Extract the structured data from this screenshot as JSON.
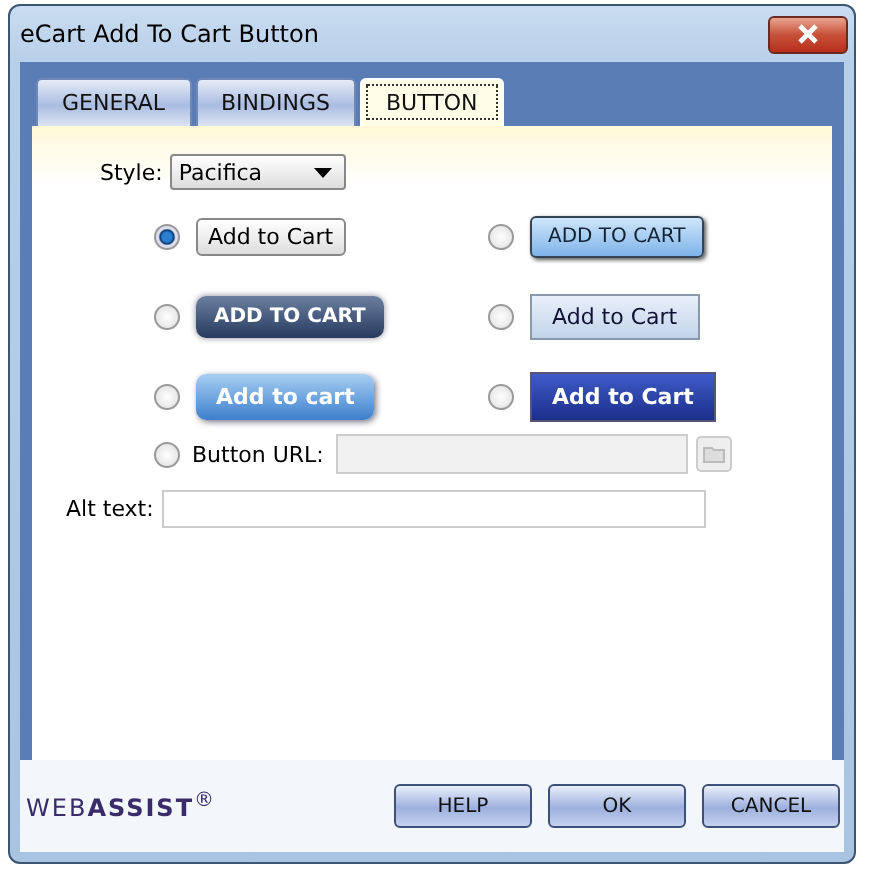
{
  "window": {
    "title": "eCart Add To Cart Button"
  },
  "tabs": [
    {
      "label": "GENERAL",
      "selected": false
    },
    {
      "label": "BINDINGS",
      "selected": false
    },
    {
      "label": "BUTTON",
      "selected": true
    }
  ],
  "style": {
    "label": "Style:",
    "value": "Pacifica"
  },
  "options": [
    {
      "kind": "plain",
      "label": "Add to Cart",
      "selected": true
    },
    {
      "kind": "sky",
      "label": "ADD TO CART",
      "selected": false
    },
    {
      "kind": "navy",
      "label": "ADD TO CART",
      "selected": false
    },
    {
      "kind": "pale",
      "label": "Add to Cart",
      "selected": false
    },
    {
      "kind": "glossy",
      "label": "Add to cart",
      "selected": false
    },
    {
      "kind": "royal",
      "label": "Add to Cart",
      "selected": false
    }
  ],
  "button_url": {
    "label": "Button URL:",
    "selected": false
  },
  "alt_text": {
    "label": "Alt text:"
  },
  "logo": "WEB**ASSIST**$^{®}$",
  "buttons": [
    "HELP",
    "OK",
    "CANCEL"
  ]
}
